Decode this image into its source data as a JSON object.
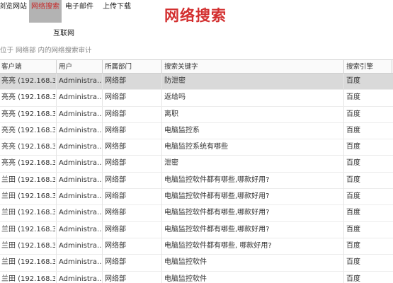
{
  "nav": {
    "items": [
      "浏览网站",
      "网络搜索",
      "电子邮件",
      "上传下载"
    ],
    "second_row": "互联网",
    "active_index": 1
  },
  "page_title": "网络搜索",
  "location": "位于 网络部 内的网络搜索审计",
  "table": {
    "headers": [
      "客户端",
      "用户",
      "所属部门",
      "搜索关键字",
      "搜索引擎"
    ],
    "rows": [
      [
        "亮亮 (192.168.3...",
        "Administra...",
        "网络部",
        "防泄密",
        "百度"
      ],
      [
        "亮亮 (192.168.3...",
        "Administra...",
        "网络部",
        "返给吗",
        "百度"
      ],
      [
        "亮亮 (192.168.3...",
        "Administra...",
        "网络部",
        "离职",
        "百度"
      ],
      [
        "亮亮 (192.168.3...",
        "Administra...",
        "网络部",
        "电脑监控系",
        "百度"
      ],
      [
        "亮亮 (192.168.3...",
        "Administra...",
        "网络部",
        "电脑监控系统有哪些",
        "百度"
      ],
      [
        "亮亮 (192.168.3...",
        "Administra...",
        "网络部",
        "泄密",
        "百度"
      ],
      [
        "兰田 (192.168.3...",
        "Administra...",
        "网络部",
        "电脑监控软件都有哪些,哪款好用?",
        "百度"
      ],
      [
        "兰田 (192.168.3...",
        "Administra...",
        "网络部",
        "电脑监控软件都有哪些,哪款好用?",
        "百度"
      ],
      [
        "兰田 (192.168.3...",
        "Administra...",
        "网络部",
        "电脑监控软件都有哪些,哪款好用?",
        "百度"
      ],
      [
        "兰田 (192.168.3...",
        "Administra...",
        "网络部",
        "电脑监控软件都有哪些,哪款好用?",
        "百度"
      ],
      [
        "兰田 (192.168.3...",
        "Administra...",
        "网络部",
        "电脑监控软件都有哪些, 哪款好用?",
        "百度"
      ],
      [
        "兰田 (192.168.3...",
        "Administra...",
        "网络部",
        "电脑监控软件",
        "百度"
      ],
      [
        "兰田 (192.168.3...",
        "Administra...",
        "网络部",
        "电脑监控软件",
        "百度"
      ]
    ],
    "selected_row": 0
  }
}
